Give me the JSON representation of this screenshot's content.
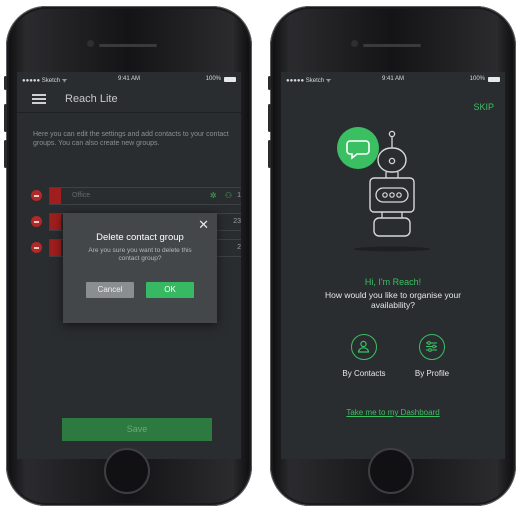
{
  "left_phone": {
    "status": {
      "carrier": "●●●●● Sketch ᯤ",
      "time": "9:41 AM",
      "battery": "100%"
    },
    "app_title": "Reach Lite",
    "intro": "Here you can edit the settings and add contacts to your contact groups. You can also create new groups.",
    "groups": [
      {
        "name": "Office",
        "count": "1",
        "color": "#a01e1e"
      },
      {
        "name": "",
        "count": "23",
        "color": "#a01e1e"
      },
      {
        "name": "",
        "count": "2",
        "color": "#a01e1e"
      }
    ],
    "dialog": {
      "title": "Delete contact group",
      "message": "Are you sure you want to delete this contact group?",
      "cancel_label": "Cancel",
      "ok_label": "OK"
    },
    "save_label": "Save"
  },
  "right_phone": {
    "status": {
      "carrier": "●●●●● Sketch ᯤ",
      "time": "9:41 AM",
      "battery": "100%"
    },
    "skip_label": "SKIP",
    "greeting": "Hi, I'm Reach!",
    "question": "How would you like to organise your availability?",
    "options": [
      {
        "label": "By Contacts",
        "icon": "person-icon"
      },
      {
        "label": "By Profile",
        "icon": "sliders-icon"
      }
    ],
    "dashboard_link": "Take me to my Dashboard"
  },
  "colors": {
    "accent_green": "#3bbf63",
    "danger_red": "#b02a2a",
    "screen_bg": "#2a2d30"
  }
}
